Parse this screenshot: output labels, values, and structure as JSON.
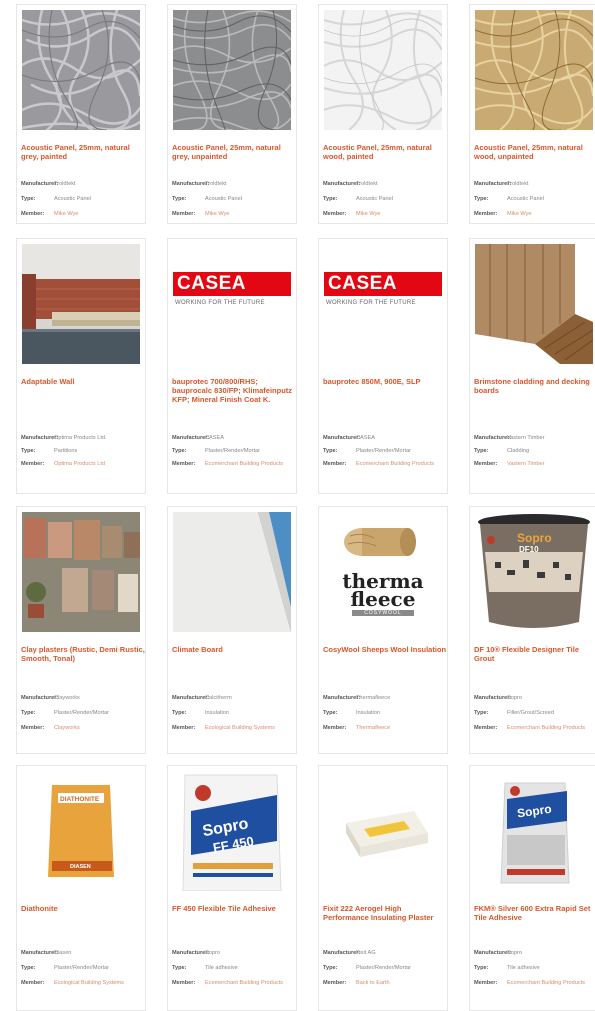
{
  "labels": {
    "manufacturer": "Manufacturer:",
    "type": "Type:",
    "member": "Member:"
  },
  "products": [
    {
      "title": "Acoustic Panel, 25mm, natural grey, painted",
      "manufacturer": "Troldtekt",
      "type": "Acoustic Panel",
      "member": "Mike Wye",
      "image": "grey-woodwool-painted"
    },
    {
      "title": "Acoustic Panel, 25mm, natural grey, unpainted",
      "manufacturer": "Troldtekt",
      "type": "Acoustic Panel",
      "member": "Mike Wye",
      "image": "grey-woodwool-unpainted"
    },
    {
      "title": "Acoustic Panel, 25mm, natural wood, painted",
      "manufacturer": "Troldtekt",
      "type": "Acoustic Panel",
      "member": "Mike Wye",
      "image": "white-woodwool"
    },
    {
      "title": "Acoustic Panel, 25mm, natural wood, unpainted",
      "manufacturer": "Troldtekt",
      "type": "Acoustic Panel",
      "member": "Mike Wye",
      "image": "wood-woodwool"
    },
    {
      "title": "Adaptable Wall",
      "manufacturer": "Optima Products Ltd.",
      "type": "Partitions",
      "member": "Optima Products Ltd",
      "image": "brick-room"
    },
    {
      "title": "bauprotec 700/800/RHS; bauprocalc 830/FP; Klimafeinputz KFP; Mineral Finish Coat K.",
      "manufacturer": "CASEA",
      "type": "Plaster/Render/Mortar",
      "member": "Ecomerchant Building Products",
      "image": "casea-logo"
    },
    {
      "title": "bauprotec 850M, 900E, SLP",
      "manufacturer": "CASEA",
      "type": "Plaster/Render/Mortar",
      "member": "Ecomerchant Building Products",
      "image": "casea-logo"
    },
    {
      "title": "Brimstone cladding and decking boards",
      "manufacturer": "Vastern Timber",
      "type": "Cladding",
      "member": "Vastern Timber",
      "image": "timber-cladding"
    },
    {
      "title": "Clay plasters (Rustic, Demi Rustic, Smooth, Tonal)",
      "manufacturer": "Clayworks",
      "type": "Plaster/Render/Mortar",
      "member": "Clayworks",
      "image": "clay-samples"
    },
    {
      "title": "Climate Board",
      "manufacturer": "Calcitherm",
      "type": "Insulation",
      "member": "Ecological Building Systems",
      "image": "white-board"
    },
    {
      "title": "CosyWool Sheeps Wool Insulation",
      "manufacturer": "Thermafleece",
      "type": "Insulation",
      "member": "Thermafleece",
      "image": "thermafleece-roll"
    },
    {
      "title": "DF 10® Flexible Designer Tile Grout",
      "manufacturer": "Sopro",
      "type": "Filler/Grout/Screed",
      "member": "Ecomerchant Building Products",
      "image": "sopro-bucket"
    },
    {
      "title": "Diathonite",
      "manufacturer": "Diasen",
      "type": "Plaster/Render/Mortar",
      "member": "Ecological Building Systems",
      "image": "diathonite-bag"
    },
    {
      "title": "FF 450 Flexible Tile Adhesive",
      "manufacturer": "Sopro",
      "type": "Tile adhesive",
      "member": "Ecomerchant Building Products",
      "image": "sopro-ff450-bag"
    },
    {
      "title": "Fixit 222 Aerogel High Performance Insulating Plaster",
      "manufacturer": "Fixit AG",
      "type": "Plaster/Render/Mortar",
      "member": "Back to Earth",
      "image": "aerogel-box"
    },
    {
      "title": "FKM® Silver 600 Extra Rapid Set Tile Adhesive",
      "manufacturer": "Sopro",
      "type": "Tile adhesive",
      "member": "Ecomerchant Building Products",
      "image": "sopro-fkm-bag"
    }
  ],
  "image_text": {
    "casea_logo": "CASEA",
    "casea_tagline": "WORKING FOR THE FUTURE",
    "therma_1": "therma",
    "therma_2": "fleece",
    "therma_3": "COSYWOOL",
    "sopro": "Sopro",
    "ff450": "FF 450",
    "df10": "DF10",
    "diathonite": "DIATHONITE",
    "diasen": "DIASEN"
  },
  "colors": {
    "title": "#d9572b",
    "link": "#d98b6d",
    "border": "#e6e6e6"
  }
}
